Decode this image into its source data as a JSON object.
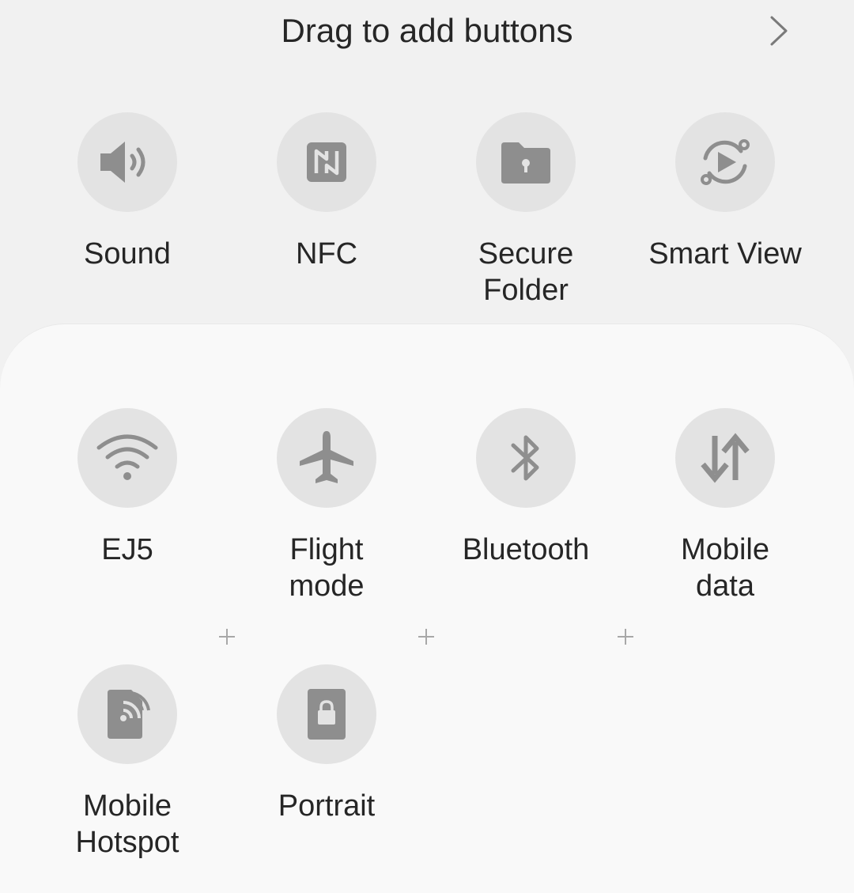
{
  "header": {
    "title": "Drag to add buttons",
    "next_icon": "chevron-right-icon"
  },
  "available_buttons": [
    {
      "label": "Sound",
      "icon": "sound-icon"
    },
    {
      "label": "NFC",
      "icon": "nfc-icon"
    },
    {
      "label": "Secure\nFolder",
      "icon": "secure-folder-icon"
    },
    {
      "label": "Smart View",
      "icon": "smart-view-icon"
    }
  ],
  "active_buttons": [
    {
      "label": "EJ5",
      "icon": "wifi-icon"
    },
    {
      "label": "Flight\nmode",
      "icon": "airplane-icon"
    },
    {
      "label": "Bluetooth",
      "icon": "bluetooth-icon"
    },
    {
      "label": "Mobile\ndata",
      "icon": "mobile-data-icon"
    },
    {
      "label": "Mobile\nHotspot",
      "icon": "hotspot-icon"
    },
    {
      "label": "Portrait",
      "icon": "portrait-lock-icon"
    }
  ],
  "drop_slots": [
    {
      "icon": "plus-icon"
    },
    {
      "icon": "plus-icon"
    },
    {
      "icon": "plus-icon"
    }
  ],
  "colors": {
    "background": "#f1f1f1",
    "panel": "#f9f9f9",
    "icon_circle": "#e3e3e3",
    "icon": "#8e8e8e",
    "text": "#262626"
  }
}
